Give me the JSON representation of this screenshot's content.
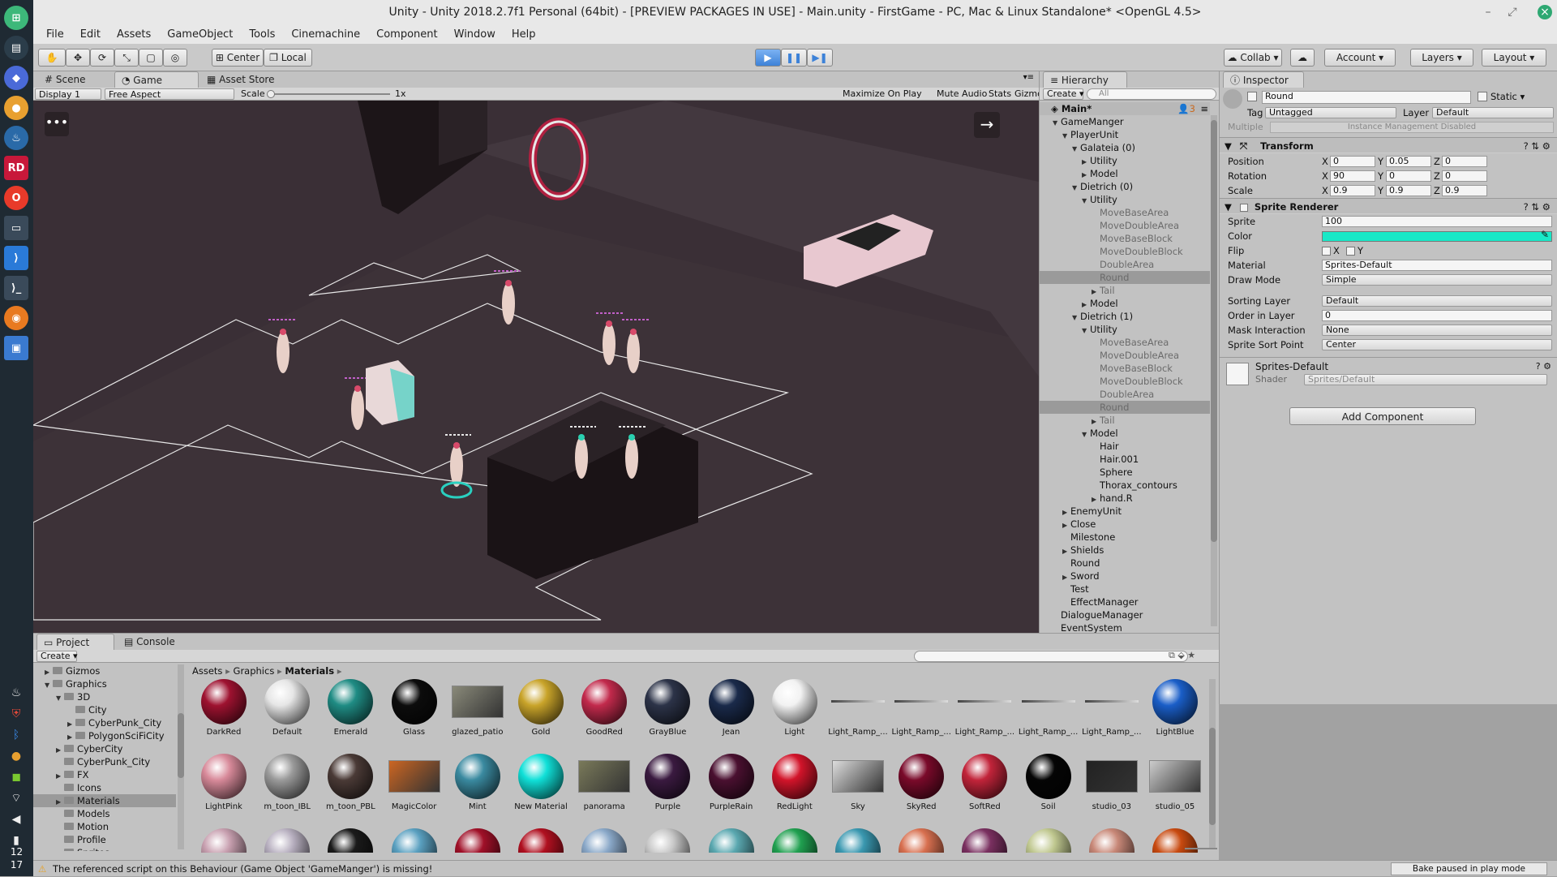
{
  "window": {
    "title": "Unity - Unity 2018.2.7f1 Personal (64bit) - [PREVIEW PACKAGES IN USE] - Main.unity - FirstGame - PC, Mac & Linux Standalone* <OpenGL 4.5>"
  },
  "menu": [
    "File",
    "Edit",
    "Assets",
    "GameObject",
    "Tools",
    "Cinemachine",
    "Component",
    "Window",
    "Help"
  ],
  "toolbar": {
    "center": "Center",
    "local": "Local",
    "collab": "Collab",
    "account": "Account",
    "layers": "Layers",
    "layout": "Layout"
  },
  "scene_tabs": {
    "scene": "Scene",
    "game": "Game",
    "asset_store": "Asset Store"
  },
  "gamebar": {
    "display": "Display 1",
    "aspect": "Free Aspect",
    "scale_label": "Scale",
    "scale_val": "1x",
    "maximize": "Maximize On Play",
    "mute": "Mute Audio",
    "stats": "Stats",
    "gizmos": "Gizmos"
  },
  "hierarchy": {
    "tab": "Hierarchy",
    "create": "Create",
    "search_placeholder": "All",
    "scene": "Main*",
    "count": "3",
    "rows": [
      {
        "label": "GameManger",
        "indent": 1,
        "arrow": "▼",
        "style": ""
      },
      {
        "label": "PlayerUnit",
        "indent": 2,
        "arrow": "▼",
        "style": ""
      },
      {
        "label": "Galateia (0)",
        "indent": 3,
        "arrow": "▼",
        "style": ""
      },
      {
        "label": "Utility",
        "indent": 4,
        "arrow": "▶",
        "style": ""
      },
      {
        "label": "Model",
        "indent": 4,
        "arrow": "▶",
        "style": ""
      },
      {
        "label": "Dietrich (0)",
        "indent": 3,
        "arrow": "▼",
        "style": ""
      },
      {
        "label": "Utility",
        "indent": 4,
        "arrow": "▼",
        "style": ""
      },
      {
        "label": "MoveBaseArea",
        "indent": 5,
        "arrow": "",
        "style": "grey"
      },
      {
        "label": "MoveDoubleArea",
        "indent": 5,
        "arrow": "",
        "style": "grey"
      },
      {
        "label": "MoveBaseBlock",
        "indent": 5,
        "arrow": "",
        "style": "grey"
      },
      {
        "label": "MoveDoubleBlock",
        "indent": 5,
        "arrow": "",
        "style": "grey"
      },
      {
        "label": "DoubleArea",
        "indent": 5,
        "arrow": "",
        "style": "grey"
      },
      {
        "label": "Round",
        "indent": 5,
        "arrow": "",
        "style": "grey sel"
      },
      {
        "label": "Tail",
        "indent": 5,
        "arrow": "▶",
        "style": "grey"
      },
      {
        "label": "Model",
        "indent": 4,
        "arrow": "▶",
        "style": ""
      },
      {
        "label": "Dietrich (1)",
        "indent": 3,
        "arrow": "▼",
        "style": ""
      },
      {
        "label": "Utility",
        "indent": 4,
        "arrow": "▼",
        "style": ""
      },
      {
        "label": "MoveBaseArea",
        "indent": 5,
        "arrow": "",
        "style": "grey"
      },
      {
        "label": "MoveDoubleArea",
        "indent": 5,
        "arrow": "",
        "style": "grey"
      },
      {
        "label": "MoveBaseBlock",
        "indent": 5,
        "arrow": "",
        "style": "grey"
      },
      {
        "label": "MoveDoubleBlock",
        "indent": 5,
        "arrow": "",
        "style": "grey"
      },
      {
        "label": "DoubleArea",
        "indent": 5,
        "arrow": "",
        "style": "grey"
      },
      {
        "label": "Round",
        "indent": 5,
        "arrow": "",
        "style": "grey sel"
      },
      {
        "label": "Tail",
        "indent": 5,
        "arrow": "▶",
        "style": "grey"
      },
      {
        "label": "Model",
        "indent": 4,
        "arrow": "▼",
        "style": ""
      },
      {
        "label": "Hair",
        "indent": 5,
        "arrow": "",
        "style": ""
      },
      {
        "label": "Hair.001",
        "indent": 5,
        "arrow": "",
        "style": ""
      },
      {
        "label": "Sphere",
        "indent": 5,
        "arrow": "",
        "style": ""
      },
      {
        "label": "Thorax_contours",
        "indent": 5,
        "arrow": "",
        "style": ""
      },
      {
        "label": "hand.R",
        "indent": 5,
        "arrow": "▶",
        "style": ""
      },
      {
        "label": "EnemyUnit",
        "indent": 2,
        "arrow": "▶",
        "style": ""
      },
      {
        "label": "Close",
        "indent": 2,
        "arrow": "▶",
        "style": ""
      },
      {
        "label": "Milestone",
        "indent": 2,
        "arrow": "",
        "style": ""
      },
      {
        "label": "Shields",
        "indent": 2,
        "arrow": "▶",
        "style": ""
      },
      {
        "label": "Round",
        "indent": 2,
        "arrow": "",
        "style": ""
      },
      {
        "label": "Sword",
        "indent": 2,
        "arrow": "▶",
        "style": ""
      },
      {
        "label": "Test",
        "indent": 2,
        "arrow": "",
        "style": ""
      },
      {
        "label": "EffectManager",
        "indent": 2,
        "arrow": "",
        "style": ""
      },
      {
        "label": "DialogueManager",
        "indent": 1,
        "arrow": "",
        "style": ""
      },
      {
        "label": "EventSystem",
        "indent": 1,
        "arrow": "",
        "style": ""
      }
    ]
  },
  "inspector": {
    "tab": "Inspector",
    "name": "Round",
    "static": "Static",
    "tag_label": "Tag",
    "tag": "Untagged",
    "layer_label": "Layer",
    "layer": "Default",
    "multiple": "Multiple",
    "multiple_note": "Instance Management Disabled",
    "transform": {
      "title": "Transform",
      "position": {
        "label": "Position",
        "x": "0",
        "y": "0.05",
        "z": "0"
      },
      "rotation": {
        "label": "Rotation",
        "x": "90",
        "y": "0",
        "z": "0"
      },
      "scale": {
        "label": "Scale",
        "x": "0.9",
        "y": "0.9",
        "z": "0.9"
      }
    },
    "sprite": {
      "title": "Sprite Renderer",
      "sprite_label": "Sprite",
      "sprite": "100",
      "color_label": "Color",
      "color": "#19e8c7",
      "flip_label": "Flip",
      "flip_x": "X",
      "flip_y": "Y",
      "material_label": "Material",
      "material": "Sprites-Default",
      "draw_label": "Draw Mode",
      "draw": "Simple",
      "sorting_label": "Sorting Layer",
      "sorting": "Default",
      "order_label": "Order in Layer",
      "order": "0",
      "mask_label": "Mask Interaction",
      "mask": "None",
      "sortpoint_label": "Sprite Sort Point",
      "sortpoint": "Center"
    },
    "material_block": {
      "name": "Sprites-Default",
      "shader_label": "Shader",
      "shader": "Sprites/Default"
    },
    "add_component": "Add Component"
  },
  "project": {
    "tab": "Project",
    "console_tab": "Console",
    "create": "Create",
    "tree": [
      {
        "label": "Gizmos",
        "indent": 1,
        "arrow": "▶",
        "sel": false
      },
      {
        "label": "Graphics",
        "indent": 1,
        "arrow": "▼",
        "sel": false
      },
      {
        "label": "3D",
        "indent": 2,
        "arrow": "▼",
        "sel": false
      },
      {
        "label": "City",
        "indent": 3,
        "arrow": "",
        "sel": false
      },
      {
        "label": "CyberPunk_City",
        "indent": 3,
        "arrow": "▶",
        "sel": false
      },
      {
        "label": "PolygonSciFiCity",
        "indent": 3,
        "arrow": "▶",
        "sel": false
      },
      {
        "label": "CyberCity",
        "indent": 2,
        "arrow": "▶",
        "sel": false
      },
      {
        "label": "CyberPunk_City",
        "indent": 2,
        "arrow": "",
        "sel": false
      },
      {
        "label": "FX",
        "indent": 2,
        "arrow": "▶",
        "sel": false
      },
      {
        "label": "Icons",
        "indent": 2,
        "arrow": "",
        "sel": false
      },
      {
        "label": "Materials",
        "indent": 2,
        "arrow": "▶",
        "sel": true
      },
      {
        "label": "Models",
        "indent": 2,
        "arrow": "",
        "sel": false
      },
      {
        "label": "Motion",
        "indent": 2,
        "arrow": "",
        "sel": false
      },
      {
        "label": "Profile",
        "indent": 2,
        "arrow": "",
        "sel": false
      },
      {
        "label": "Sprites",
        "indent": 2,
        "arrow": "",
        "sel": false
      }
    ],
    "breadcrumb": [
      "Assets",
      "Graphics",
      "Materials"
    ],
    "row1": [
      {
        "name": "DarkRed",
        "color": "#9e1230",
        "kind": "ball"
      },
      {
        "name": "Default",
        "color": "#e6e6e6",
        "kind": "ball"
      },
      {
        "name": "Emerald",
        "color": "#1f8c84",
        "kind": "ball"
      },
      {
        "name": "Glass",
        "color": "#0c0c0c",
        "kind": "ball"
      },
      {
        "name": "glazed_patio",
        "color": "#8a8a7a",
        "kind": "tex"
      },
      {
        "name": "Gold",
        "color": "#c9a42a",
        "kind": "ball"
      },
      {
        "name": "GoodRed",
        "color": "#c22a4c",
        "kind": "ball"
      },
      {
        "name": "GrayBlue",
        "color": "#2c3348",
        "kind": "ball"
      },
      {
        "name": "Jean",
        "color": "#1a2a4a",
        "kind": "ball"
      },
      {
        "name": "Light",
        "color": "#f2f2f2",
        "kind": "ball"
      },
      {
        "name": "Light_Ramp_...",
        "color": "#888888",
        "kind": "line"
      },
      {
        "name": "Light_Ramp_...",
        "color": "#888888",
        "kind": "line"
      },
      {
        "name": "Light_Ramp_...",
        "color": "#888888",
        "kind": "line"
      },
      {
        "name": "Light_Ramp_...",
        "color": "#888888",
        "kind": "line"
      },
      {
        "name": "Light_Ramp_...",
        "color": "#888888",
        "kind": "line"
      },
      {
        "name": "LightBlue",
        "color": "#1a5ec8",
        "kind": "ball"
      }
    ],
    "row2": [
      {
        "name": "LightPink",
        "color": "#d88a9a",
        "kind": "ball"
      },
      {
        "name": "m_toon_IBL",
        "color": "#9a9a9a",
        "kind": "ball"
      },
      {
        "name": "m_toon_PBL",
        "color": "#4a3a36",
        "kind": "ball"
      },
      {
        "name": "MagicColor",
        "color": "#cc6622",
        "kind": "tex"
      },
      {
        "name": "Mint",
        "color": "#3a8aa0",
        "kind": "ball"
      },
      {
        "name": "New Material",
        "color": "#10e0d8",
        "kind": "ball"
      },
      {
        "name": "panorama",
        "color": "#7a7a5a",
        "kind": "tex"
      },
      {
        "name": "Purple",
        "color": "#3a1a40",
        "kind": "ball"
      },
      {
        "name": "PurpleRain",
        "color": "#4a1030",
        "kind": "ball"
      },
      {
        "name": "RedLight",
        "color": "#d2142a",
        "kind": "ball"
      },
      {
        "name": "Sky",
        "color": "#dddddd",
        "kind": "tex"
      },
      {
        "name": "SkyRed",
        "color": "#7a0a2a",
        "kind": "ball"
      },
      {
        "name": "SoftRed",
        "color": "#c2243a",
        "kind": "ball"
      },
      {
        "name": "Soil",
        "color": "#050505",
        "kind": "ball"
      },
      {
        "name": "studio_03",
        "color": "#222222",
        "kind": "tex"
      },
      {
        "name": "studio_05",
        "color": "#cccccc",
        "kind": "tex"
      }
    ],
    "row3_colors": [
      "#c8a0b0",
      "#b8b0c0",
      "#1a1a1a",
      "#5aa0c0",
      "#a01028",
      "#b01020",
      "#8aa8c8",
      "#c8c8c8",
      "#5aa8b0",
      "#20a050",
      "#3a98b0",
      "#d87050",
      "#7a3060",
      "#c0c890",
      "#c88878",
      "#c84a10"
    ]
  },
  "status": {
    "message": "The referenced script on this Behaviour (Game Object 'GameManger') is missing!",
    "bake": "Bake paused in play mode"
  },
  "dock_clock": {
    "h": "12",
    "m": "17"
  }
}
